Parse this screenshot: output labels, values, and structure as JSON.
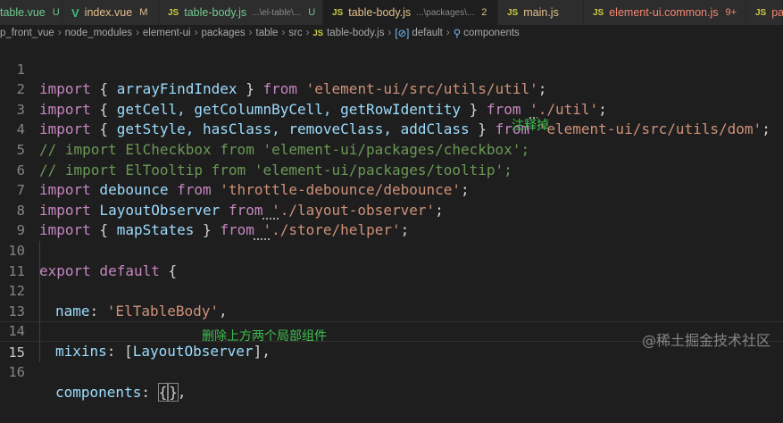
{
  "tabs": [
    {
      "label": "table.vue",
      "type": "vue",
      "mark": "U",
      "color": "green"
    },
    {
      "label": "index.vue",
      "type": "vue",
      "mark": "M",
      "color": "yellow"
    },
    {
      "label": "table-body.js",
      "type": "js",
      "path": "...\\el-table\\...",
      "mark": "U",
      "color": "green"
    },
    {
      "label": "table-body.js",
      "type": "js",
      "path": "...\\packages\\...",
      "mark": "2",
      "color": "yellow",
      "active": true
    },
    {
      "label": "main.js",
      "type": "js",
      "mark": "",
      "color": "yellow"
    },
    {
      "label": "element-ui.common.js",
      "type": "js",
      "mark": "9+",
      "color": "red"
    },
    {
      "label": "pac",
      "type": "js",
      "mark": "",
      "color": "red"
    }
  ],
  "breadcrumb": [
    "p_front_vue",
    "node_modules",
    "element-ui",
    "packages",
    "table",
    "src",
    "table-body.js",
    "default",
    "components"
  ],
  "code": {
    "l1": {
      "n": "1",
      "kw": "import",
      "a": " { ",
      "b": "arrayFindIndex",
      "c": " } ",
      "from": "from",
      "s": "'element-ui/src/utils/util'",
      "e": ";"
    },
    "l2": {
      "n": "2",
      "kw": "import",
      "a": " { ",
      "b": "getCell, getColumnByCell, getRowIdentity",
      "c": " } ",
      "from": "from",
      "s0": "'",
      "s": "./util'",
      "e": ";"
    },
    "l3": {
      "n": "3",
      "kw": "import",
      "a": " { ",
      "b": "getStyle, hasClass, removeClass, addClass",
      "c": " } ",
      "from": "from",
      "s": "'element-ui/src/utils/dom'",
      "e": ";"
    },
    "l4": {
      "n": "4",
      "text": "// import ElCheckbox from 'element-ui/packages/checkbox';"
    },
    "l5": {
      "n": "5",
      "text": "// import ElTooltip from 'element-ui/packages/tooltip';"
    },
    "l6": {
      "n": "6",
      "kw": "import",
      "b": " debounce ",
      "from": "from",
      "s": " 'throttle-debounce/debounce'",
      "e": ";"
    },
    "l7": {
      "n": "7",
      "kw": "import",
      "b": " LayoutObserver ",
      "from": "from",
      "s0": " '",
      "s": "./layout-observer'",
      "e": ";"
    },
    "l8": {
      "n": "8",
      "kw": "import",
      "a": " { ",
      "b": "mapStates",
      "c": " } ",
      "from": "from",
      "s0": " '",
      "s": "./store/helper'",
      "e": ";"
    },
    "l9": {
      "n": "9"
    },
    "l10": {
      "n": "10",
      "kw": "export",
      "kw2": " default",
      "c": " {"
    },
    "l11": {
      "n": "11",
      "prop": "name",
      "p": ": ",
      "s": "'ElTableBody'",
      "e": ","
    },
    "l12": {
      "n": "12"
    },
    "l13": {
      "n": "13",
      "prop": "mixins",
      "p": ": [",
      "b": "LayoutObserver",
      "e": "],"
    },
    "l14": {
      "n": "14"
    },
    "l15": {
      "n": "15",
      "prop": "components",
      "p": ": ",
      "o": "{",
      "cl": "}",
      "e": ","
    },
    "l16": {
      "n": "16"
    }
  },
  "notes": {
    "remove_note": "注释掉",
    "delete_note": "删除上方两个局部组件"
  },
  "watermark": "@稀土掘金技术社区"
}
